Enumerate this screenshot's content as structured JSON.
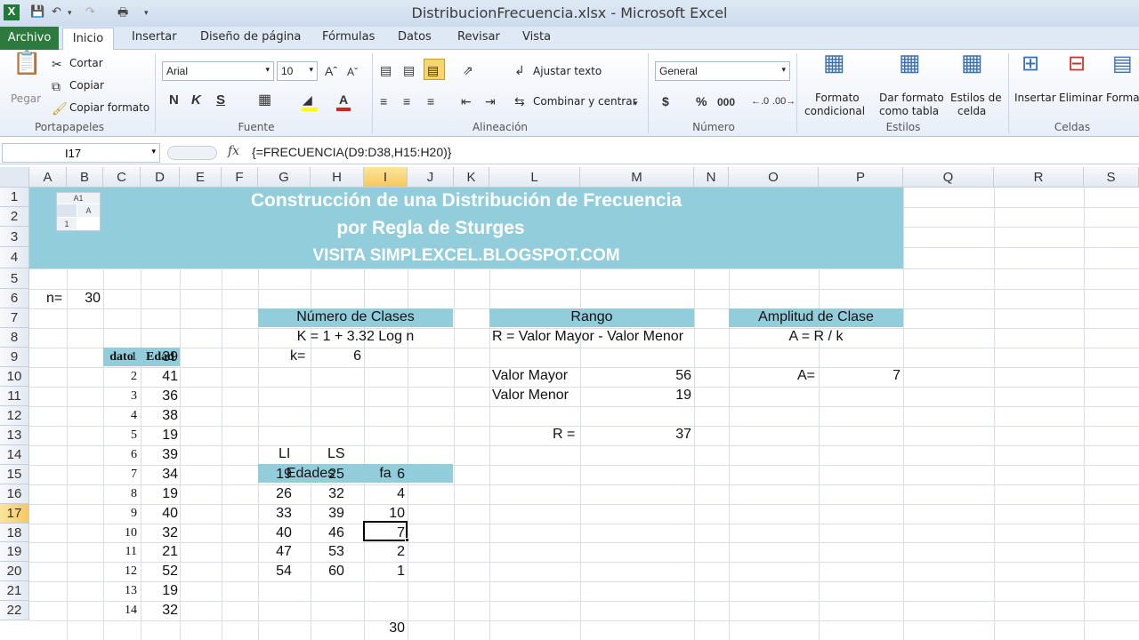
{
  "window": {
    "title": "DistribucionFrecuencia.xlsx  -  Microsoft Excel"
  },
  "tabs": [
    "Archivo",
    "Inicio",
    "Insertar",
    "Diseño de página",
    "Fórmulas",
    "Datos",
    "Revisar",
    "Vista"
  ],
  "ribbon": {
    "clipboard": {
      "paste": "Pegar",
      "cut": "Cortar",
      "copy": "Copiar",
      "format_painter": "Copiar formato",
      "label": "Portapapeles"
    },
    "font": {
      "name": "Arial",
      "size": "10",
      "bold": "N",
      "italic": "K",
      "underline": "S",
      "label": "Fuente"
    },
    "alignment": {
      "wrap": "Ajustar texto",
      "merge": "Combinar y centrar",
      "label": "Alineación"
    },
    "number": {
      "format": "General",
      "currency": "$",
      "percent": "%",
      "thousands": "000",
      "label": "Número"
    },
    "styles": {
      "cond_1": "Formato",
      "cond_2": "condicional",
      "table_1": "Dar formato",
      "table_2": "como tabla",
      "cell_1": "Estilos de",
      "cell_2": "celda",
      "label": "Estilos"
    },
    "cells": {
      "insert": "Insertar",
      "delete": "Eliminar",
      "format": "Forma",
      "label": "Celdas"
    }
  },
  "formula_bar": {
    "name_box": "I17",
    "fx": "fx",
    "formula": "{=FRECUENCIA(D9:D38,H15:H20)}"
  },
  "columns": [
    "A",
    "B",
    "C",
    "D",
    "E",
    "F",
    "G",
    "H",
    "I",
    "J",
    "K",
    "L",
    "M",
    "N",
    "O",
    "P",
    "Q",
    "R",
    "S"
  ],
  "rows": [
    "1",
    "2",
    "3",
    "4",
    "5",
    "6",
    "7",
    "8",
    "9",
    "10",
    "11",
    "12",
    "13",
    "14",
    "15",
    "16",
    "17",
    "18",
    "19",
    "20",
    "21",
    "22"
  ],
  "banner": {
    "line1": "Construcción de una Distribución de Frecuencia",
    "line2": "por Regla de Sturges",
    "line3": "VISITA SIMPLEXCEL.BLOGSPOT.COM"
  },
  "logo": {
    "a1": "A1",
    "a": "A",
    "one": "1"
  },
  "n_label": "n=",
  "n_value": "30",
  "clases": {
    "header": "Número de Clases",
    "formula": "K = 1 + 3.32 Log n",
    "k_label": "k=",
    "k_value": "6"
  },
  "rango": {
    "header": "Rango",
    "formula": "R = Valor Mayor - Valor Menor",
    "max_label": "Valor Mayor",
    "max_value": "56",
    "min_label": "Valor Menor",
    "min_value": "19",
    "r_label": "R =",
    "r_value": "37"
  },
  "amplitud": {
    "header": "Amplitud de Clase",
    "formula": "A = R / k",
    "a_label": "A=",
    "a_value": "7"
  },
  "datos": {
    "h_dato": "dato",
    "h_edad": "Edad",
    "rows": [
      [
        "1",
        "39"
      ],
      [
        "2",
        "41"
      ],
      [
        "3",
        "36"
      ],
      [
        "4",
        "38"
      ],
      [
        "5",
        "19"
      ],
      [
        "6",
        "39"
      ],
      [
        "7",
        "34"
      ],
      [
        "8",
        "19"
      ],
      [
        "9",
        "40"
      ],
      [
        "10",
        "32"
      ],
      [
        "11",
        "21"
      ],
      [
        "12",
        "52"
      ],
      [
        "13",
        "19"
      ],
      [
        "14",
        "32"
      ]
    ]
  },
  "freq": {
    "li": "LI",
    "ls": "LS",
    "edades": "Edades",
    "fa": "fa",
    "rows": [
      [
        "19",
        "25",
        "6"
      ],
      [
        "26",
        "32",
        "4"
      ],
      [
        "33",
        "39",
        "10"
      ],
      [
        "40",
        "46",
        "7"
      ],
      [
        "47",
        "53",
        "2"
      ],
      [
        "54",
        "60",
        "1"
      ]
    ],
    "total": "30"
  }
}
